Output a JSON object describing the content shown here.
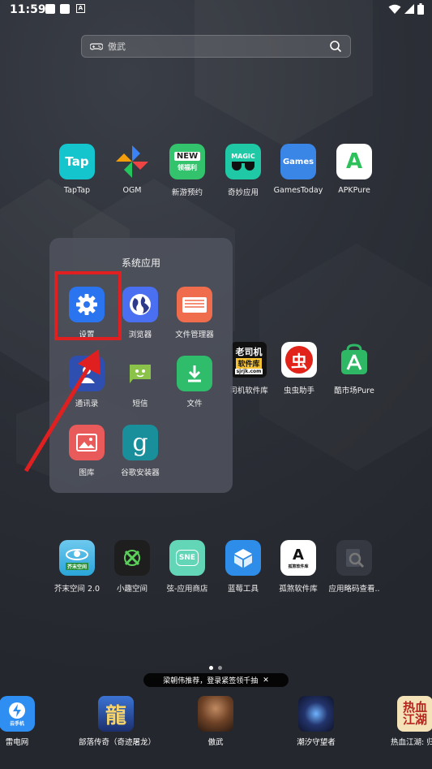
{
  "status_bar": {
    "time": "11:59"
  },
  "search": {
    "text": "傲武"
  },
  "row1": [
    {
      "label": "TapTap",
      "glyph": "Tap",
      "icon": "taptap-icon",
      "color": "#15c5ce"
    },
    {
      "label": "OGM",
      "icon": "pinwheel-icon"
    },
    {
      "label": "新游预约",
      "glyph": "NEW",
      "sub": "领福利",
      "icon": "new-games-icon",
      "color": "#32c36c"
    },
    {
      "label": "奇妙应用",
      "glyph": "MAGIC",
      "icon": "magic-app-icon",
      "color": "#1fc9a5"
    },
    {
      "label": "GamesToday",
      "glyph": "Games",
      "icon": "gamestoday-icon",
      "color": "#3a86e6"
    },
    {
      "label": "APKPure",
      "glyph": "A",
      "icon": "apkpure-icon",
      "color": "#2ec05a"
    }
  ],
  "folder": {
    "title": "系统应用",
    "apps": [
      {
        "label": "设置",
        "icon": "gear-icon",
        "color": "#2b74f0"
      },
      {
        "label": "浏览器",
        "icon": "globe-icon",
        "color": "#4a6ff0"
      },
      {
        "label": "文件管理器",
        "icon": "folder-icon",
        "color": "#ef6c4c"
      },
      {
        "label": "通讯录",
        "icon": "contacts-icon",
        "color": "#2e4fb0"
      },
      {
        "label": "短信",
        "icon": "sms-icon",
        "color": "#8bc34a"
      },
      {
        "label": "文件",
        "icon": "download-icon",
        "color": "#2fbd6c"
      },
      {
        "label": "图库",
        "icon": "gallery-icon",
        "color": "#e95a5a"
      },
      {
        "label": "谷歌安装器",
        "glyph": "g",
        "icon": "google-installer-icon",
        "color": "#1a8f9c"
      }
    ]
  },
  "row_mid": [
    {
      "label": "司机软件库",
      "glyph": "老司机",
      "sub": "软件库",
      "caption": "sjrjk.com",
      "icon": "laosiji-icon"
    },
    {
      "label": "虫虫助手",
      "glyph": "虫",
      "icon": "chongchong-icon"
    },
    {
      "label": "酷市场Pure",
      "icon": "kushichang-icon",
      "color": "#2eb865"
    }
  ],
  "row3": [
    {
      "label": "芥末空间 2.0",
      "caption": "芥末空间",
      "icon": "jiemo-icon",
      "color": "#2aa5d8"
    },
    {
      "label": "小趣空间",
      "icon": "xiaoqu-icon",
      "color": "#1e1e1e"
    },
    {
      "label": "弦-应用商店",
      "caption": "SNE",
      "icon": "xian-store-icon",
      "color": "#63d6b8"
    },
    {
      "label": "蓝莓工具",
      "icon": "box-icon",
      "color": "#2e8de8"
    },
    {
      "label": "孤煞软件库",
      "glyph": "A",
      "caption": "孤煞软件库",
      "icon": "gusha-icon",
      "color": "#ffffff"
    },
    {
      "label": "应用略码查看..",
      "icon": "search-app-icon",
      "color": "#353840"
    }
  ],
  "page_dots": {
    "count": 2,
    "active": 0
  },
  "banner": {
    "text": "梁朝伟推荐，登录紧签领千抽",
    "close": "✕"
  },
  "dock": [
    {
      "label": "雷电网",
      "caption": "云手机",
      "icon": "leidian-icon",
      "color": "#2f8ef2"
    },
    {
      "label": "部落传奇（奇迹屠龙）",
      "glyph": "龍",
      "icon": "buluo-game-icon",
      "color": "#2a5ab0"
    },
    {
      "label": "傲武",
      "icon": "aowu-game-icon",
      "color": "#5a3a26"
    },
    {
      "label": "潮汐守望者",
      "icon": "tide-guardian-icon",
      "color": "#1b2448"
    },
    {
      "label": "热血江湖: 归",
      "glyph": "热血",
      "sub": "江湖",
      "icon": "rexue-game-icon",
      "color": "#f4e2b8"
    }
  ]
}
